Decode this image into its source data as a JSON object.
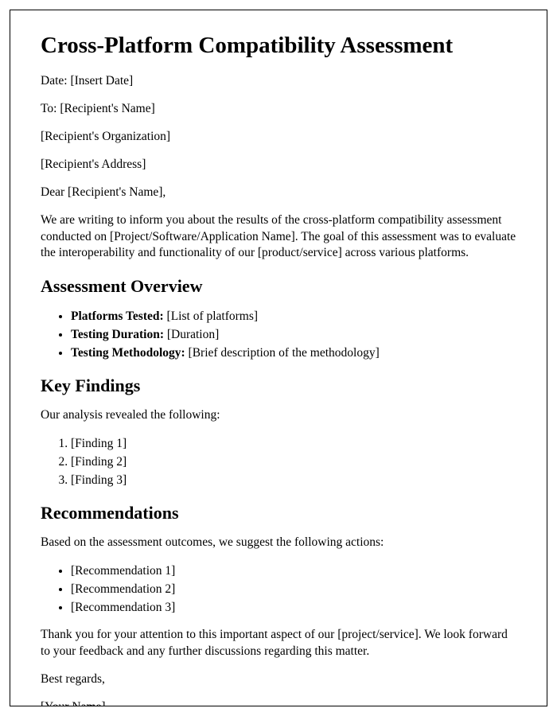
{
  "title": "Cross-Platform Compatibility Assessment",
  "meta": {
    "date": "Date: [Insert Date]",
    "to": "To: [Recipient's Name]",
    "org": "[Recipient's Organization]",
    "address": "[Recipient's Address]",
    "salutation": "Dear [Recipient's Name],"
  },
  "intro": "We are writing to inform you about the results of the cross-platform compatibility assessment conducted on [Project/Software/Application Name]. The goal of this assessment was to evaluate the interoperability and functionality of our [product/service] across various platforms.",
  "overview": {
    "heading": "Assessment Overview",
    "items": {
      "platforms_label": "Platforms Tested:",
      "platforms_value": " [List of platforms]",
      "duration_label": "Testing Duration:",
      "duration_value": " [Duration]",
      "methodology_label": "Testing Methodology:",
      "methodology_value": " [Brief description of the methodology]"
    }
  },
  "findings": {
    "heading": "Key Findings",
    "intro": "Our analysis revealed the following:",
    "items": {
      "f1": "[Finding 1]",
      "f2": "[Finding 2]",
      "f3": "[Finding 3]"
    }
  },
  "recommendations": {
    "heading": "Recommendations",
    "intro": "Based on the assessment outcomes, we suggest the following actions:",
    "items": {
      "r1": "[Recommendation 1]",
      "r2": "[Recommendation 2]",
      "r3": "[Recommendation 3]"
    }
  },
  "closing": {
    "thanks": "Thank you for your attention to this important aspect of our [project/service]. We look forward to your feedback and any further discussions regarding this matter.",
    "signoff": "Best regards,",
    "name": "[Your Name]"
  }
}
